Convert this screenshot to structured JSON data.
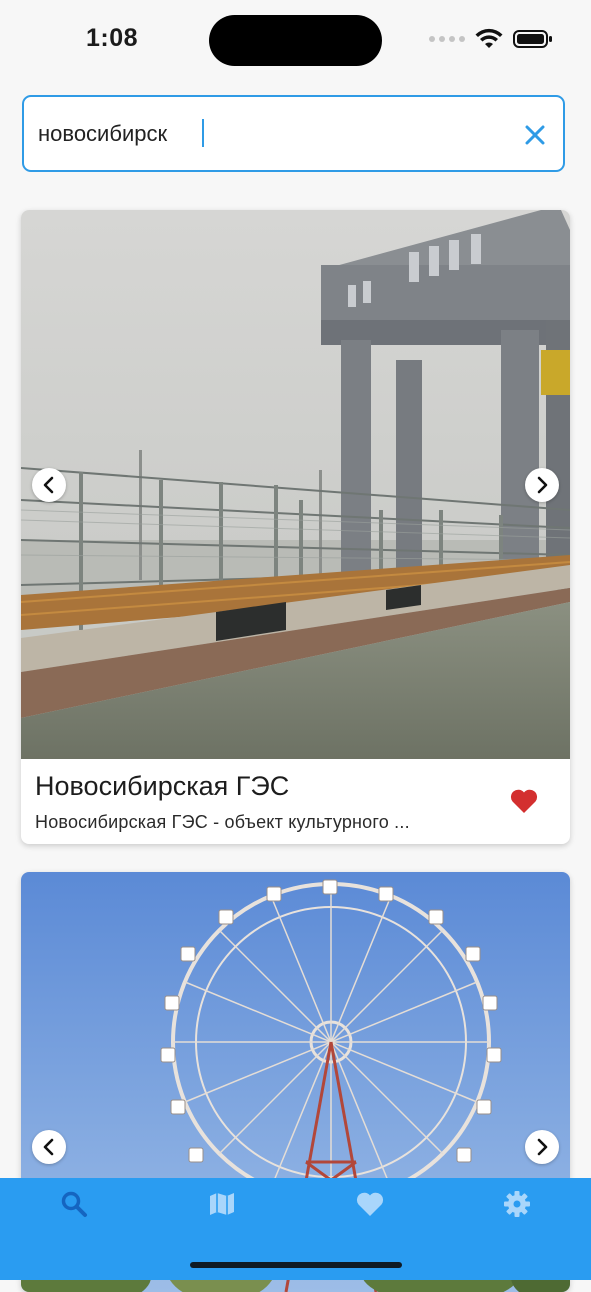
{
  "status_bar": {
    "time": "1:08"
  },
  "search": {
    "value": "новосибирск",
    "placeholder": ""
  },
  "cards": [
    {
      "title": "Новосибирская ГЭС",
      "description": "Новосибирская ГЭС - объект культурного ...",
      "favorite": true,
      "image_subject": "hydroelectric-station-crane-gantry"
    },
    {
      "title": "",
      "description": "",
      "favorite": false,
      "image_subject": "ferris-wheel"
    }
  ],
  "bottom_nav": {
    "items": [
      {
        "icon": "search-icon",
        "selected": true
      },
      {
        "icon": "map-icon",
        "selected": false
      },
      {
        "icon": "heart-icon",
        "selected": false
      },
      {
        "icon": "gear-icon",
        "selected": false
      }
    ]
  },
  "colors": {
    "accent": "#2f9be6",
    "nav_background": "#2a9cf1",
    "nav_icon_selected": "#1565c0",
    "nav_icon_default": "#a9d6fb",
    "favorite": "#d32f2f"
  }
}
